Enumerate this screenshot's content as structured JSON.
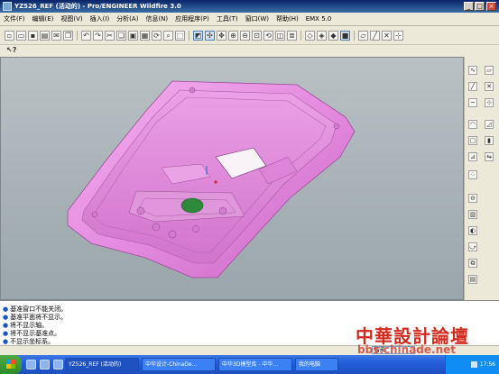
{
  "window": {
    "title": "YZ526_REF (活动的) - Pro/ENGINEER Wildfire 3.0",
    "controls": {
      "minimize": "_",
      "maximize": "□",
      "close": "×"
    }
  },
  "menu": {
    "items": [
      {
        "label": "文件(F)"
      },
      {
        "label": "编辑(E)"
      },
      {
        "label": "视图(V)"
      },
      {
        "label": "插入(I)"
      },
      {
        "label": "分析(A)"
      },
      {
        "label": "信息(N)"
      },
      {
        "label": "应用程序(P)"
      },
      {
        "label": "工具(T)"
      },
      {
        "label": "窗口(W)"
      },
      {
        "label": "帮助(H)"
      },
      {
        "label": "EMX 5.0"
      }
    ]
  },
  "toolbar_main": {
    "buttons": [
      "new-icon",
      "open-icon",
      "save-icon",
      "print-icon",
      "email-icon",
      "copy-icon",
      "undo-icon",
      "redo-icon",
      "cut-icon",
      "copy2-icon",
      "paste-icon",
      "paste-special-icon",
      "regenerate-icon",
      "find-icon",
      "select-box-icon",
      "repaint-icon",
      "spin-center-icon",
      "orient-icon",
      "zoom-in-icon",
      "zoom-out-icon",
      "refit-icon",
      "reorient-icon",
      "saved-views-icon",
      "layers-icon",
      "wireframe-icon",
      "hidden-line-icon",
      "no-hidden-icon",
      "shading-icon",
      "datum-plane-icon",
      "datum-axis-icon",
      "datum-point-icon",
      "datum-csys-icon"
    ]
  },
  "toolbar_second": {
    "context_help_icon": "context-help-icon"
  },
  "right_tools": {
    "icons": [
      "sketch-icon",
      "plane-icon",
      "axis-icon",
      "point-icon",
      "curve-icon",
      "csys-icon",
      "round-icon",
      "chamfer-icon",
      "shell-icon",
      "rib-icon",
      "draft-icon",
      "mirror-icon",
      "pattern-icon",
      "hole-icon",
      "extrude-icon",
      "revolve-icon",
      "sweep-icon",
      "blend-icon",
      "analysis-icon"
    ]
  },
  "messages": {
    "lines": [
      "基准窗口不能关闭。",
      "基准平面将不显示。",
      "将不显示轴。",
      "将不显示基准点。",
      "不显示坐标系。"
    ]
  },
  "selection_filter": {
    "value": "智能"
  },
  "watermark": {
    "big": "中華設計論壇",
    "small": "bbs.chinade.net"
  },
  "taskbar": {
    "tasks": [
      {
        "label": "YZ526_REF (活动的)",
        "active": true
      },
      {
        "label": "中华设计-ChinaDe..."
      },
      {
        "label": "中华3D模型库 - 中华..."
      },
      {
        "label": "我的电脑"
      }
    ],
    "clock": "17:56"
  },
  "colors": {
    "model": "#e58ce0",
    "viewport_bg": "#a8b1b5",
    "hole": "#2e8a3b"
  }
}
